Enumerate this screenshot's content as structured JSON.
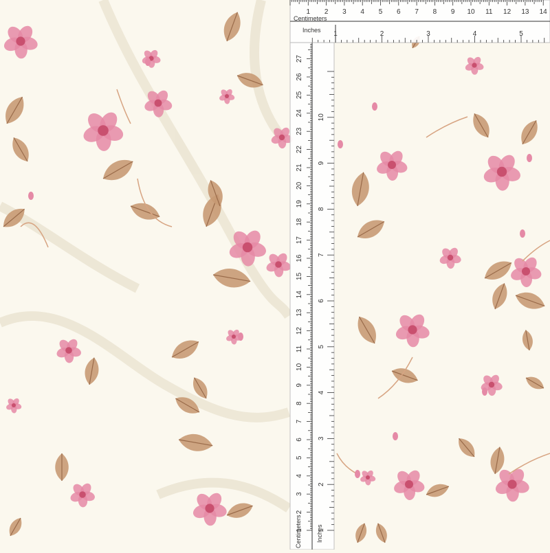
{
  "image": {
    "subject": "cream floral fabric with scale rulers",
    "background_color": "#fbf8ee",
    "petal_color": "#e58aa6",
    "petal_dark_color": "#c9506f",
    "leaf_color": "#c89a74",
    "leaf_vein_color": "#9a6b4a",
    "stem_color": "#d7a482"
  },
  "ruler_horizontal": {
    "centimeters_label": "Centimeters",
    "inches_label": "Inches",
    "cm_ticks": [
      "1",
      "2",
      "3",
      "4",
      "5",
      "6",
      "7",
      "8",
      "9",
      "10",
      "11",
      "12",
      "13",
      "14"
    ],
    "inch_ticks": [
      "1",
      "2",
      "3",
      "4",
      "5"
    ]
  },
  "ruler_vertical": {
    "centimeters_label": "Centimeters",
    "inches_label": "Inches",
    "cm_ticks": [
      "1",
      "2",
      "3",
      "4",
      "5",
      "6",
      "7",
      "8",
      "9",
      "10",
      "11",
      "12",
      "13",
      "14",
      "15",
      "16",
      "17",
      "18",
      "19",
      "20",
      "21",
      "22",
      "23",
      "24",
      "25",
      "26",
      "27"
    ],
    "inch_ticks": [
      "1",
      "2",
      "3",
      "4",
      "5",
      "6",
      "7",
      "8",
      "9",
      "10"
    ]
  }
}
